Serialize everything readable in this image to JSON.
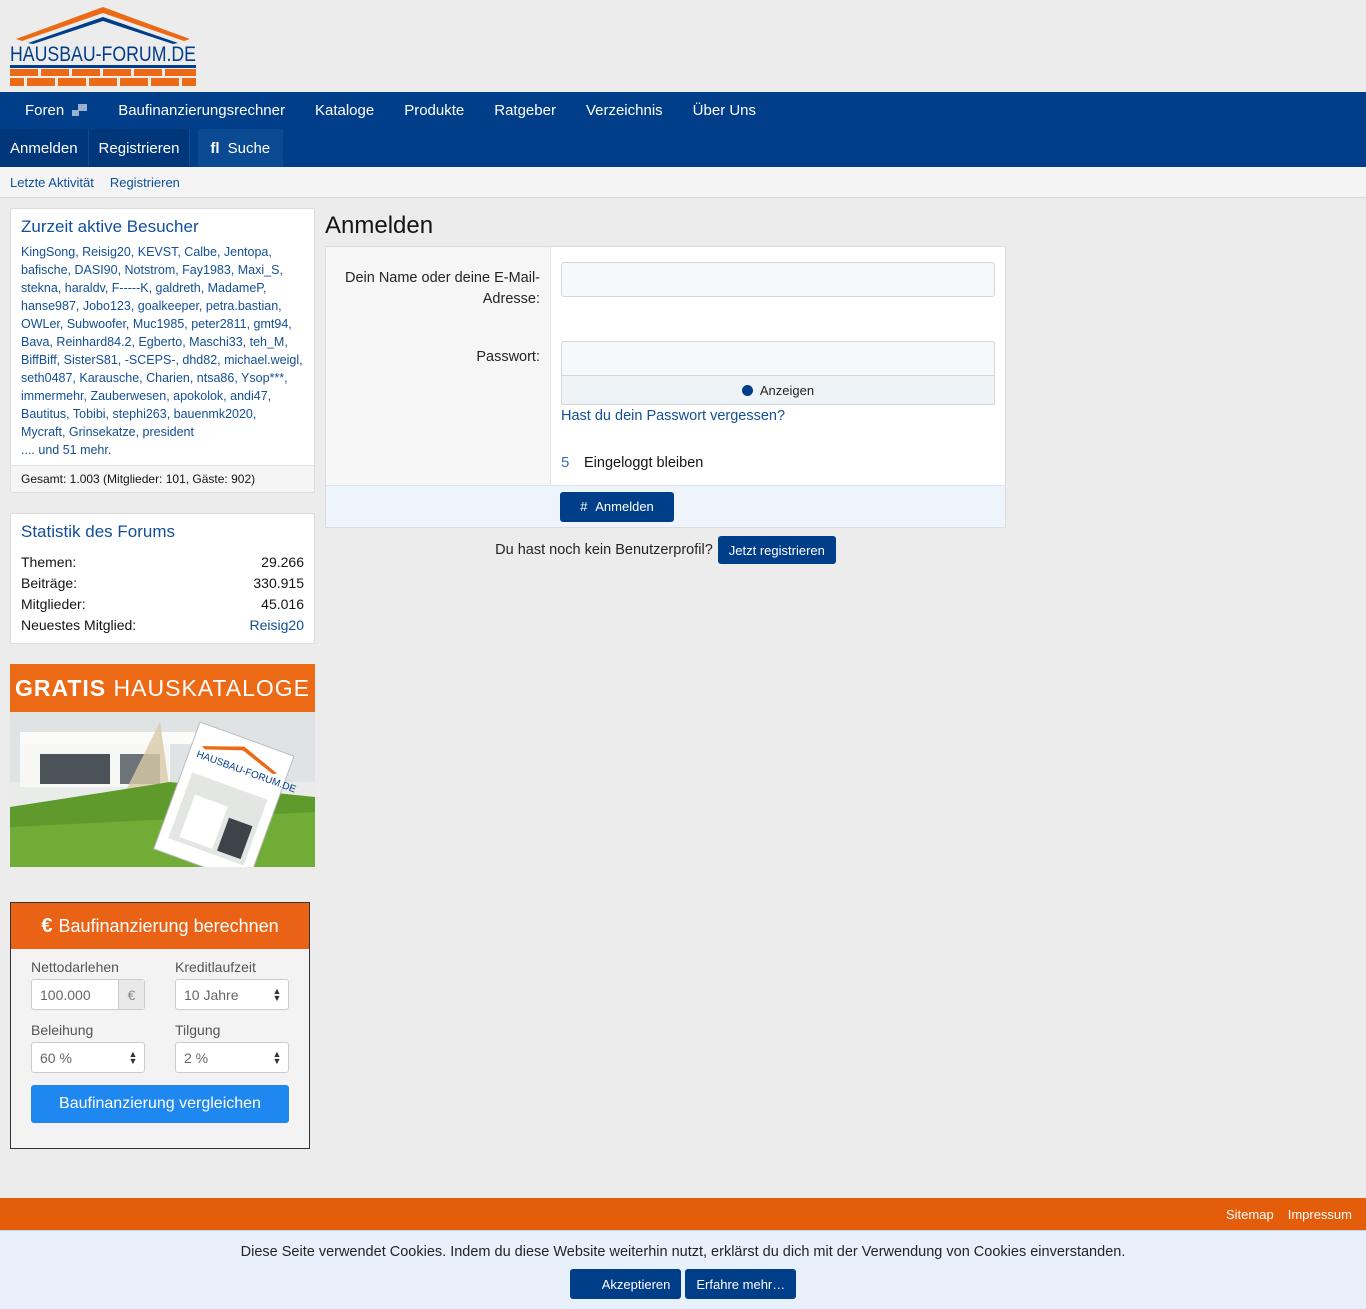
{
  "logo": {
    "text": "HAUSBAU-FORUM.DE",
    "colors": {
      "roof": "#ec6a16",
      "text": "#003e8a",
      "bricks": "#ec6a16"
    }
  },
  "nav": {
    "tabs": [
      {
        "label": "Foren",
        "icon": "forum-icon"
      },
      {
        "label": "Baufinanzierungsrechner"
      },
      {
        "label": "Kataloge"
      },
      {
        "label": "Produkte"
      },
      {
        "label": "Ratgeber"
      },
      {
        "label": "Verzeichnis"
      },
      {
        "label": "Über Uns"
      }
    ],
    "login": "Anmelden",
    "register": "Registrieren",
    "search": "Suche"
  },
  "subnav": {
    "latest": "Letzte Aktivität",
    "register": "Registrieren"
  },
  "visitors": {
    "title": "Zurzeit aktive Besucher",
    "names": "KingSong, Reisig20, KEVST, Calbe, Jentopa, bafische, DASI90, Notstrom, Fay1983, Maxi_S, stekna, haraldv, F-----K, galdreth, MadameP, hanse987, Jobo123, goalkeeper, petra.bastian, OWLer, Subwoofer, Muc1985, peter2811, gmt94, Bava, Reinhard84.2, Egberto, Maschi33, teh_M, BiffBiff, SisterS81, -SCEPS-, dhd82, michael.weigl, seth0487, Karausche, Charien, ntsa86, Ysop***, immermehr, Zauberwesen, apokolok, andi47, Bautitus, Tobibi, stephi263, bauenmk2020, Mycraft, Grinsekatze, president",
    "more": ".... und 51 mehr.",
    "total": "Gesamt: 1.003 (Mitglieder: 101, Gäste: 902)"
  },
  "stats": {
    "title": "Statistik des Forums",
    "rows": [
      {
        "label": "Themen:",
        "value": "29.266"
      },
      {
        "label": "Beiträge:",
        "value": "330.915"
      },
      {
        "label": "Mitglieder:",
        "value": "45.016"
      },
      {
        "label": "Neuestes Mitglied:",
        "value": "Reisig20"
      }
    ]
  },
  "ad": {
    "bold": "GRATIS",
    "light": "HAUSKATALOGE",
    "brochure": "HAUSBAU-FORUM.DE"
  },
  "calculator": {
    "title": "Baufinanzierung berechnen",
    "currency_symbol": "€",
    "fields": {
      "loan_label": "Nettodarlehen",
      "loan_value": "100.000",
      "loan_unit": "€",
      "term_label": "Kreditlaufzeit",
      "term_value": "10 Jahre",
      "ltv_label": "Beleihung",
      "ltv_value": "60 %",
      "repay_label": "Tilgung",
      "repay_value": "2 %"
    },
    "button": "Baufinanzierung vergleichen"
  },
  "login": {
    "title": "Anmelden",
    "name_label": "Dein Name oder deine E-Mail-Adresse:",
    "password_label": "Passwort:",
    "show_label": "Anzeigen",
    "forgot": "Hast du dein Passwort vergessen?",
    "remember_glyph": "5",
    "remember": "Eingeloggt bleiben",
    "submit_glyph": "#",
    "submit": "Anmelden",
    "no_profile": "Du hast noch kein Benutzerprofil?",
    "register_now": "Jetzt registrieren"
  },
  "footer": {
    "sitemap": "Sitemap",
    "impressum": "Impressum"
  },
  "cookie": {
    "text": "Diese Seite verwendet Cookies. Indem du diese Website weiterhin nutzt, erklärst du dich mit der Verwendung von Cookies einverstanden.",
    "accept": "Akzeptieren",
    "learn_more": "Erfahre mehr…"
  }
}
